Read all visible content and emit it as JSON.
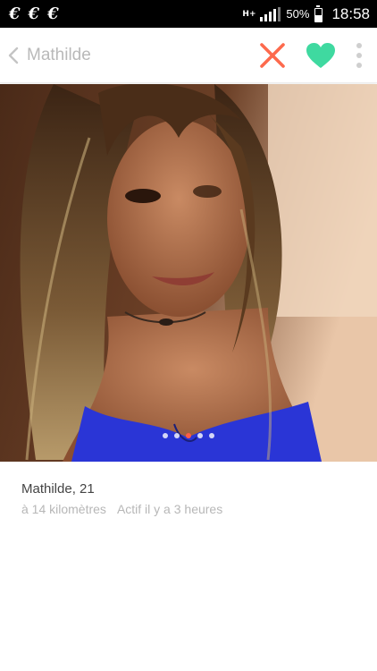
{
  "status_bar": {
    "notifications": [
      "€",
      "€",
      "€"
    ],
    "network_type": "H+",
    "battery_percent": "50%",
    "battery_level": 0.5,
    "time": "18:58"
  },
  "header": {
    "title": "Mathilde",
    "back_icon": "chevron-left-icon",
    "nope_icon": "close-icon",
    "like_icon": "heart-icon",
    "more_icon": "more-vertical-icon",
    "colors": {
      "nope": "#fd6a4d",
      "like": "#3fd9a0",
      "title": "#b9b9b9"
    }
  },
  "photo": {
    "description_icon": "profile-photo",
    "total": 5,
    "active_index": 2
  },
  "profile": {
    "name_age": "Mathilde, 21",
    "distance": "à 14 kilomètres",
    "activity": "Actif il y a 3 heures"
  }
}
